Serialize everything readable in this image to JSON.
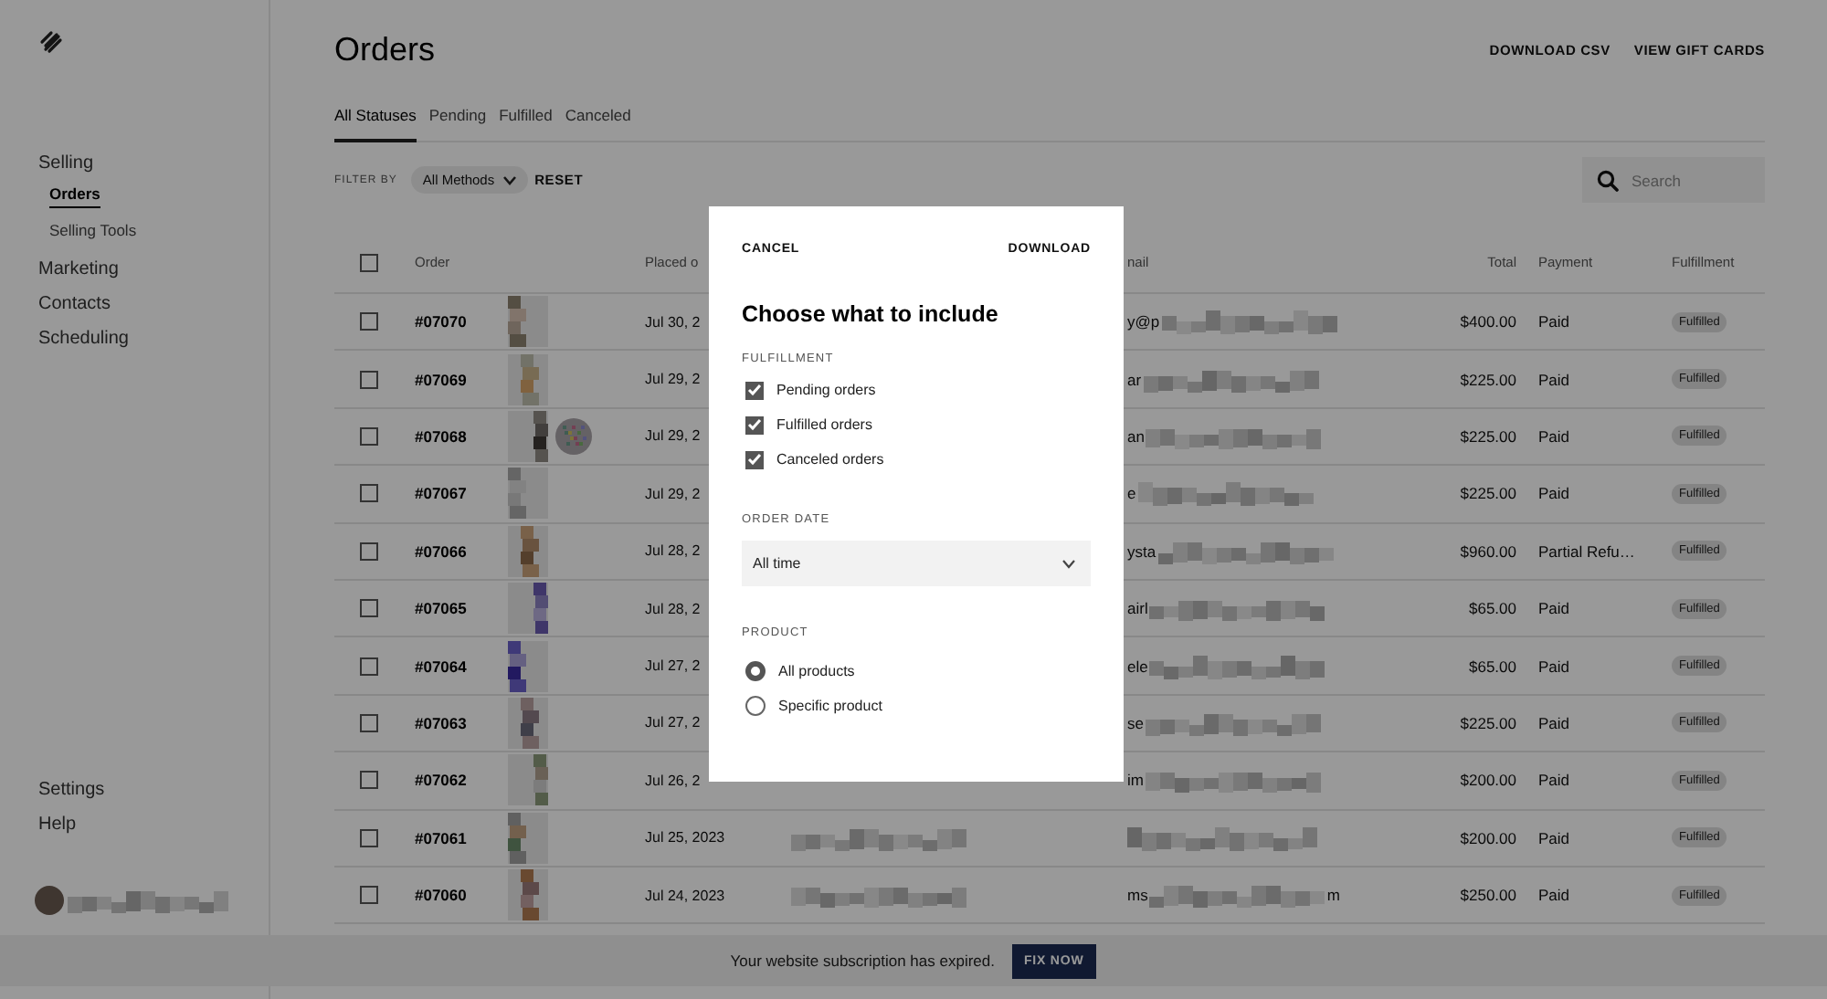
{
  "sidebar": {
    "nav": [
      {
        "label": "Selling",
        "selected": false,
        "children": [
          {
            "label": "Orders",
            "selected": true
          },
          {
            "label": "Selling Tools",
            "selected": false
          }
        ]
      },
      {
        "label": "Marketing",
        "selected": false
      },
      {
        "label": "Contacts",
        "selected": false
      },
      {
        "label": "Scheduling",
        "selected": false
      }
    ],
    "footer_items": [
      {
        "label": "Settings",
        "selected": false
      },
      {
        "label": "Help",
        "selected": false
      }
    ]
  },
  "header": {
    "title": "Orders",
    "actions": [
      "DOWNLOAD CSV",
      "VIEW GIFT CARDS"
    ]
  },
  "tabs": [
    {
      "label": "All Statuses",
      "selected": true
    },
    {
      "label": "Pending",
      "selected": false
    },
    {
      "label": "Fulfilled",
      "selected": false
    },
    {
      "label": "Canceled",
      "selected": false
    }
  ],
  "filter": {
    "label": "FILTER BY",
    "dropdown": "All Methods",
    "reset": "RESET",
    "search": {
      "placeholder": "Search"
    }
  },
  "table": {
    "select_all_checked": false,
    "columns": [
      "Order",
      "Placed o",
      "nail",
      "Total",
      "Payment",
      "Fulfillment"
    ],
    "rows": [
      {
        "checked": false,
        "order": "#07070",
        "images": [
          {
            "kind": "picture"
          }
        ],
        "date": "Jul 30, 2",
        "email": [
          "y@p"
        ],
        "total": "$400.00",
        "payment": "Paid",
        "fulfillment": "Fulfilled"
      },
      {
        "checked": false,
        "order": "#07069",
        "images": [
          {
            "kind": "picture"
          }
        ],
        "date": "Jul 29, 2",
        "email": [
          "ar"
        ],
        "total": "$225.00",
        "payment": "Paid",
        "fulfillment": "Fulfilled"
      },
      {
        "checked": false,
        "order": "#07068",
        "images": [
          {
            "kind": "picture"
          },
          {
            "kind": "picture"
          }
        ],
        "date": "Jul 29, 2",
        "email": [
          "an"
        ],
        "total": "$225.00",
        "payment": "Paid",
        "fulfillment": "Fulfilled"
      },
      {
        "checked": false,
        "order": "#07067",
        "images": [
          {
            "kind": "picture"
          }
        ],
        "date": "Jul 29, 2",
        "email": [
          "e"
        ],
        "total": "$225.00",
        "payment": "Paid",
        "fulfillment": "Fulfilled"
      },
      {
        "checked": false,
        "order": "#07066",
        "images": [
          {
            "kind": "picture"
          }
        ],
        "date": "Jul 28, 2",
        "email": [
          "ysta"
        ],
        "total": "$960.00",
        "payment": "Partial Refu…",
        "fulfillment": "Fulfilled"
      },
      {
        "checked": false,
        "order": "#07065",
        "images": [
          {
            "kind": "picture"
          }
        ],
        "date": "Jul 28, 2",
        "email": [
          "airl"
        ],
        "total": "$65.00",
        "payment": "Paid",
        "fulfillment": "Fulfilled"
      },
      {
        "checked": false,
        "order": "#07064",
        "images": [
          {
            "kind": "picture"
          }
        ],
        "date": "Jul 27, 2",
        "email": [
          "ele"
        ],
        "total": "$65.00",
        "payment": "Paid",
        "fulfillment": "Fulfilled"
      },
      {
        "checked": false,
        "order": "#07063",
        "images": [
          {
            "kind": "picture"
          }
        ],
        "date": "Jul 27, 2",
        "email": [
          "se"
        ],
        "total": "$225.00",
        "payment": "Paid",
        "fulfillment": "Fulfilled"
      },
      {
        "checked": false,
        "order": "#07062",
        "images": [
          {
            "kind": "picture"
          }
        ],
        "date": "Jul 26, 2",
        "email": [
          "im"
        ],
        "total": "$200.00",
        "payment": "Paid",
        "fulfillment": "Fulfilled"
      },
      {
        "checked": false,
        "order": "#07061",
        "images": [
          {
            "kind": "picture"
          }
        ],
        "date": "Jul 25, 2023",
        "customer_redacted": true,
        "total": "$200.00",
        "payment": "Paid",
        "fulfillment": "Fulfilled"
      },
      {
        "checked": false,
        "order": "#07060",
        "images": [
          {
            "kind": "picture"
          }
        ],
        "date": "Jul 24, 2023",
        "customer_redacted": true,
        "email": [
          "ms",
          "m"
        ],
        "total": "$250.00",
        "payment": "Paid",
        "fulfillment": "Fulfilled"
      }
    ]
  },
  "modal": {
    "cancel": "CANCEL",
    "download": "DOWNLOAD",
    "title": "Choose what to include",
    "fulfillment": {
      "label": "FULFILLMENT",
      "options": [
        {
          "label": "Pending orders",
          "checked": true
        },
        {
          "label": "Fulfilled orders",
          "checked": true
        },
        {
          "label": "Canceled orders",
          "checked": true
        }
      ]
    },
    "order_date": {
      "label": "ORDER DATE",
      "value": "All time"
    },
    "product": {
      "label": "PRODUCT",
      "options": [
        {
          "label": "All products",
          "selected": true
        },
        {
          "label": "Specific product",
          "selected": false
        }
      ]
    }
  },
  "banner": {
    "text": "Your website subscription has expired.",
    "button": "FIX NOW"
  }
}
